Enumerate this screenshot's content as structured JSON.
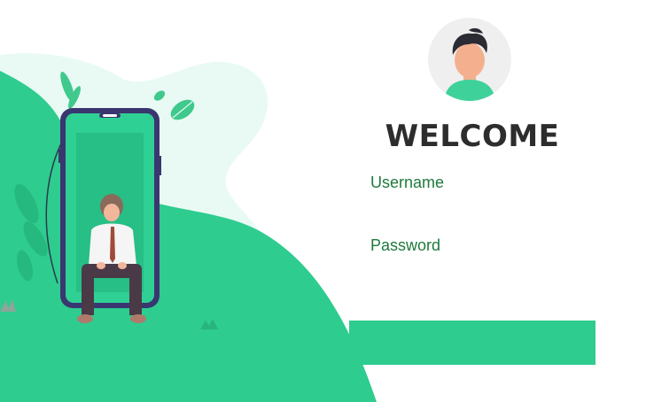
{
  "header": {
    "title": "WELCOME"
  },
  "form": {
    "username_label": "Username",
    "username_value": "",
    "password_label": "Password",
    "password_value": "",
    "submit_label": ""
  },
  "icons": {
    "avatar": "user-avatar-icon",
    "leaf": "leaf-icon"
  },
  "colors": {
    "accent": "#2ecc8f",
    "label": "#1f7a3c",
    "title": "#2d2d2d",
    "phone_frame": "#3a3670",
    "light_blob": "#e8faf3"
  }
}
